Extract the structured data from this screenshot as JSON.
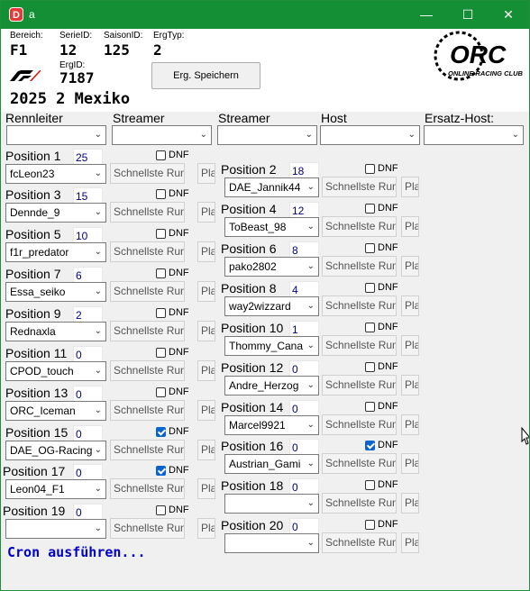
{
  "window": {
    "title": "a",
    "icon_letter": "D",
    "controls": [
      "—",
      "☐",
      "✕"
    ]
  },
  "header": {
    "bereich_label": "Bereich:",
    "bereich_value": "F1",
    "serie_label": "SerieID:",
    "serie_value": "12",
    "saison_label": "SaisonID:",
    "saison_value": "125",
    "ergtyp_label": "ErgTyp:",
    "ergtyp_value": "2",
    "ergid_label": "ErgID:",
    "ergid_value": "7187",
    "save_button": "Erg. Speichern",
    "race_title": "2025 2 Mexiko",
    "orc_logo_text": "ORC",
    "orc_logo_sub": "ONLINE RACING CLUB"
  },
  "roles": [
    {
      "label": "Rennleiter",
      "value": ""
    },
    {
      "label": "Streamer",
      "value": ""
    },
    {
      "label": "Streamer",
      "value": ""
    },
    {
      "label": "Host",
      "value": ""
    },
    {
      "label": "Ersatz-Host:",
      "value": ""
    }
  ],
  "positions": [
    {
      "label": "Position 1",
      "points": "25",
      "driver": "fcLeon23",
      "dnf": false
    },
    {
      "label": "Position 2",
      "points": "18",
      "driver": "DAE_Jannik44",
      "dnf": false
    },
    {
      "label": "Position 3",
      "points": "15",
      "driver": "Dennde_9",
      "dnf": false
    },
    {
      "label": "Position 4",
      "points": "12",
      "driver": "ToBeast_98",
      "dnf": false
    },
    {
      "label": "Position 5",
      "points": "10",
      "driver": "f1r_predator",
      "dnf": false
    },
    {
      "label": "Position 6",
      "points": "8",
      "driver": "pako2802",
      "dnf": false
    },
    {
      "label": "Position 7",
      "points": "6",
      "driver": "Essa_seiko",
      "dnf": false
    },
    {
      "label": "Position 8",
      "points": "4",
      "driver": "way2wizzard",
      "dnf": false
    },
    {
      "label": "Position 9",
      "points": "2",
      "driver": "Rednaxla",
      "dnf": false
    },
    {
      "label": "Position 10",
      "points": "1",
      "driver": "Thommy_Cana",
      "dnf": false
    },
    {
      "label": "Position 11",
      "points": "0",
      "driver": "CPOD_touch",
      "dnf": false
    },
    {
      "label": "Position 12",
      "points": "0",
      "driver": "Andre_Herzog",
      "dnf": false
    },
    {
      "label": "Position 13",
      "points": "0",
      "driver": "ORC_Iceman",
      "dnf": false
    },
    {
      "label": "Position 14",
      "points": "0",
      "driver": "Marcel9921",
      "dnf": false
    },
    {
      "label": "Position 15",
      "points": "0",
      "driver": "DAE_OG-Racing",
      "dnf": true
    },
    {
      "label": "Position 16",
      "points": "0",
      "driver": "Austrian_Gami",
      "dnf": true
    },
    {
      "label": "Position 17",
      "points": "0",
      "driver": "Leon04_F1",
      "dnf": true
    },
    {
      "label": "Position 18",
      "points": "0",
      "driver": "",
      "dnf": false
    },
    {
      "label": "Position 19",
      "points": "0",
      "driver": "",
      "dnf": false
    },
    {
      "label": "Position 20",
      "points": "0",
      "driver": "",
      "dnf": false
    }
  ],
  "row_labels": {
    "dnf": "DNF",
    "fastest_lap": "Schnellste Runde",
    "pla": "Pla"
  },
  "footer": {
    "cron_label": "Cron ausführen..."
  }
}
